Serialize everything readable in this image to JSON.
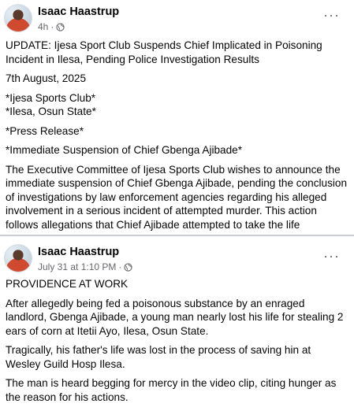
{
  "post1": {
    "author": "Isaac Haastrup",
    "time": "4h",
    "separator": "·",
    "paragraphs": [
      "UPDATE: Ijesa Sport Club Suspends Chief Implicated in Poisoning Incident in Ilesa, Pending Police Investigation Results",
      "7th August, 2025",
      "*Ijesa Sports Club*",
      "*Ilesa, Osun State*",
      "*Press Release*",
      "*Immediate Suspension of Chief Gbenga Ajibade*",
      "The Executive Committee of Ijesa Sports Club wishes to announce the immediate suspension of Chief Gbenga Ajibade, pending the conclusion of investigations by law enforcement agencies regarding his alleged involvement in a serious incident of attempted murder. This action follows allegations that Chief Ajibade attempted to take the life"
    ],
    "audience_icon": "globe-icon",
    "more_icon": "more-options-icon"
  },
  "post2": {
    "author": "Isaac Haastrup",
    "time": "July 31 at 1:10 PM",
    "separator": "·",
    "paragraphs": [
      "PROVIDENCE AT WORK",
      "After allegedly being fed a poisonous substance by an enraged landlord, Gbenga Ajibade, a young man nearly lost his life for stealing 2 ears of corn at Itetii Ayo, Ilesa, Osun State.",
      "Tragically, his father's life was lost in the process of saving hin at Wesley Guild Hosp Ilesa.",
      "The man is heard begging for mercy in the video clip, citing hunger as the reason for his actions."
    ],
    "audience_icon": "globe-icon",
    "more_icon": "more-options-icon"
  },
  "more_glyph": "···",
  "colors": {
    "text": "#050505",
    "secondary_text": "#65676b",
    "divider": "#c9ccd1"
  }
}
